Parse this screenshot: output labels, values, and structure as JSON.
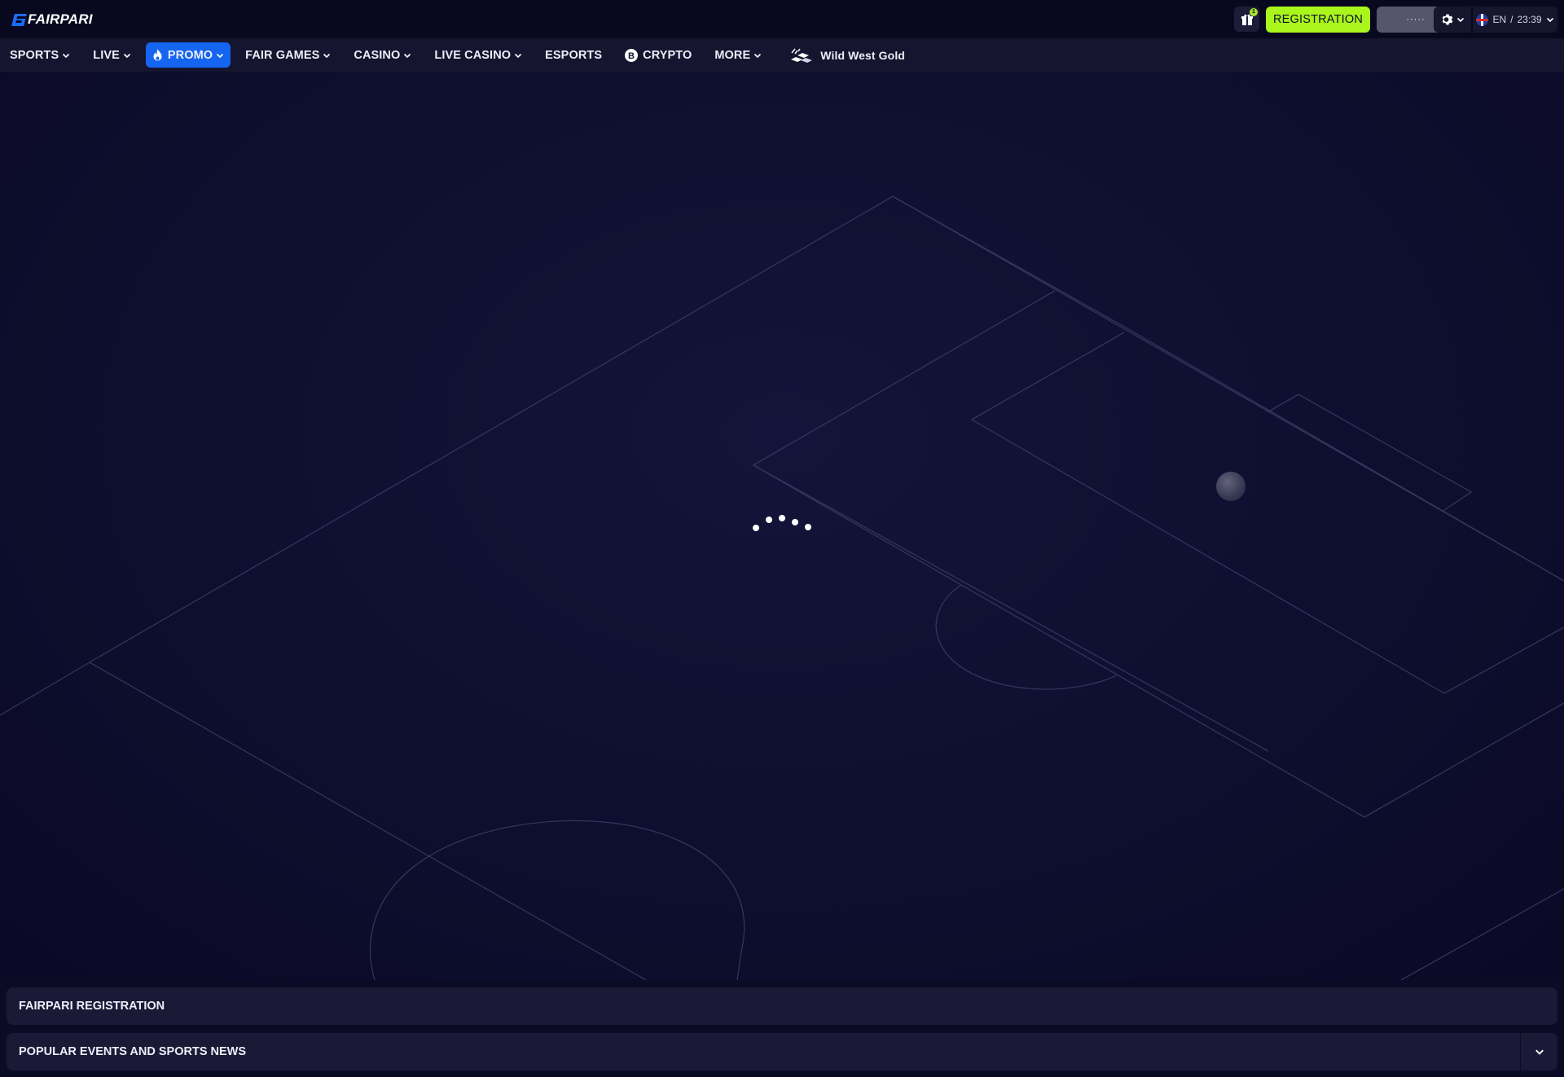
{
  "header": {
    "logo_text": "FAIRPARI",
    "gift_badge_count": "1",
    "registration_label": "REGISTRATION",
    "login_label": "·····",
    "language": "EN",
    "time_separator": "/",
    "time": "23:39"
  },
  "nav": {
    "items": [
      {
        "label": "SPORTS",
        "has_dropdown": true
      },
      {
        "label": "LIVE",
        "has_dropdown": true
      },
      {
        "label": "PROMO",
        "has_dropdown": true,
        "active": true,
        "icon": "flame-icon"
      },
      {
        "label": "FAIR GAMES",
        "has_dropdown": true
      },
      {
        "label": "CASINO",
        "has_dropdown": true
      },
      {
        "label": "LIVE CASINO",
        "has_dropdown": true
      },
      {
        "label": "ESPORTS",
        "has_dropdown": false
      },
      {
        "label": "CRYPTO",
        "has_dropdown": false,
        "icon": "bitcoin-icon"
      },
      {
        "label": "MORE",
        "has_dropdown": true
      },
      {
        "label": "Wild West Gold",
        "has_dropdown": false,
        "icon": "gold-bars-icon"
      }
    ]
  },
  "footer": {
    "registration_title": "FAIRPARI REGISTRATION",
    "popular_title": "POPULAR EVENTS AND SPORTS NEWS"
  },
  "colors": {
    "accent_blue": "#1565f0",
    "registration_green": "#a9f51c",
    "background": "#0b0b25"
  }
}
